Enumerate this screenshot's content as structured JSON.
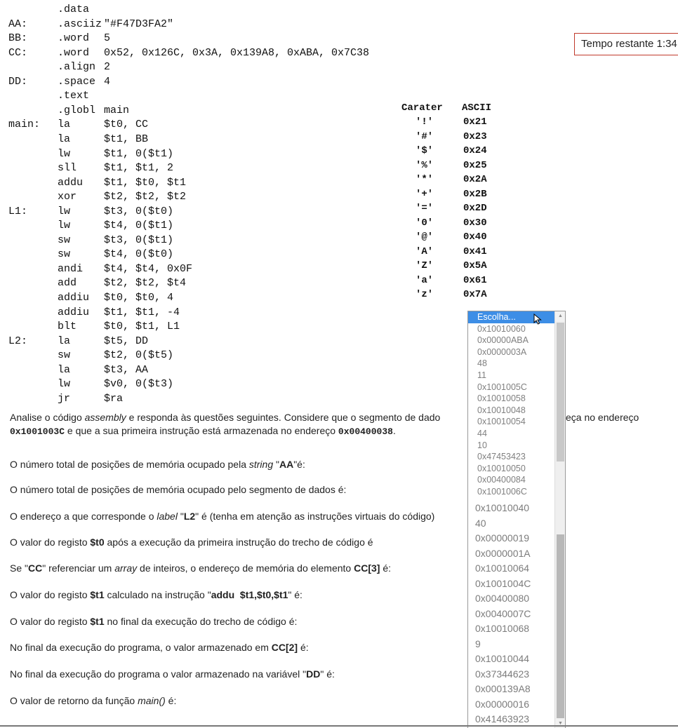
{
  "timer": {
    "text": "Tempo restante 1:34"
  },
  "code": [
    {
      "label": "",
      "op": ".data",
      "args": ""
    },
    {
      "label": "AA:",
      "op": ".asciiz",
      "args": "\"#F47D3FA2\""
    },
    {
      "label": "BB:",
      "op": ".word",
      "args": "5"
    },
    {
      "label": "CC:",
      "op": ".word",
      "args": "0x52, 0x126C, 0x3A, 0x139A8, 0xABA, 0x7C38"
    },
    {
      "label": "",
      "op": ".align",
      "args": "2"
    },
    {
      "label": "DD:",
      "op": ".space",
      "args": "4"
    },
    {
      "label": "",
      "op": ".text",
      "args": ""
    },
    {
      "label": "",
      "op": ".globl",
      "args": "main"
    },
    {
      "label": "main:",
      "op": "la",
      "args": "$t0, CC"
    },
    {
      "label": "",
      "op": "la",
      "args": "$t1, BB"
    },
    {
      "label": "",
      "op": "lw",
      "args": "$t1, 0($t1)"
    },
    {
      "label": "",
      "op": "sll",
      "args": "$t1, $t1, 2"
    },
    {
      "label": "",
      "op": "addu",
      "args": "$t1, $t0, $t1"
    },
    {
      "label": "",
      "op": "xor",
      "args": "$t2, $t2, $t2"
    },
    {
      "label": "L1:",
      "op": "lw",
      "args": "$t3, 0($t0)"
    },
    {
      "label": "",
      "op": "lw",
      "args": "$t4, 0($t1)"
    },
    {
      "label": "",
      "op": "sw",
      "args": "$t3, 0($t1)"
    },
    {
      "label": "",
      "op": "sw",
      "args": "$t4, 0($t0)"
    },
    {
      "label": "",
      "op": "andi",
      "args": "$t4, $t4, 0x0F"
    },
    {
      "label": "",
      "op": "add",
      "args": "$t2, $t2, $t4"
    },
    {
      "label": "",
      "op": "addiu",
      "args": "$t0, $t0, 4"
    },
    {
      "label": "",
      "op": "addiu",
      "args": "$t1, $t1, -4"
    },
    {
      "label": "",
      "op": "blt",
      "args": "$t0, $t1, L1"
    },
    {
      "label": "L2:",
      "op": "la",
      "args": "$t5, DD"
    },
    {
      "label": "",
      "op": "sw",
      "args": "$t2, 0($t5)"
    },
    {
      "label": "",
      "op": "la",
      "args": "$t3, AA"
    },
    {
      "label": "",
      "op": "lw",
      "args": "$v0, 0($t3)"
    },
    {
      "label": "",
      "op": "jr",
      "args": "$ra"
    }
  ],
  "ascii_table": {
    "header_char": "Carater",
    "header_code": "ASCII",
    "rows": [
      {
        "char": "'!'",
        "hex": "0x21"
      },
      {
        "char": "'#'",
        "hex": "0x23"
      },
      {
        "char": "'$'",
        "hex": "0x24"
      },
      {
        "char": "'%'",
        "hex": "0x25"
      },
      {
        "char": "'*'",
        "hex": "0x2A"
      },
      {
        "char": "'+'",
        "hex": "0x2B"
      },
      {
        "char": "'='",
        "hex": "0x2D"
      },
      {
        "char": "'0'",
        "hex": "0x30"
      },
      {
        "char": "'@'",
        "hex": "0x40"
      },
      {
        "char": "'A'",
        "hex": "0x41"
      },
      {
        "char": "'Z'",
        "hex": "0x5A"
      },
      {
        "char": "'a'",
        "hex": "0x61"
      },
      {
        "char": "'z'",
        "hex": "0x7A"
      }
    ]
  },
  "intro": {
    "p1": "Analise o código ",
    "p1_em": "assembly",
    "p2": " e responda às questões seguintes. Considere que o segmento de dado",
    "p2_cont": "eça no endereço",
    "addr1": "0x1001003C",
    "p3": " e que a sua primeira instrução está armazenada no endereço ",
    "addr2": "0x00400038",
    "p4": "."
  },
  "questions": {
    "q1": {
      "a": "O número total de posições de memória ocupado pela ",
      "em": "string",
      "b": " \"",
      "strong": "AA",
      "c": "\"é:"
    },
    "q2": {
      "a": "O número total de posições de memória ocupado pelo segmento de dados é:"
    },
    "q3": {
      "a": "O endereço a que corresponde o ",
      "em": "label",
      "b": " \"",
      "strong": "L2",
      "c": "\" é (tenha em atenção as instruções virtuais do código)"
    },
    "q4": {
      "a": "O valor do registo ",
      "strong": "$t0",
      "b": " após a execução da primeira instrução do trecho de código é"
    },
    "q5": {
      "a": "Se \"",
      "strong": "CC",
      "b": "\" referenciar um ",
      "em": "array",
      "c": " de inteiros, o endereço de memória do elemento ",
      "strong2": "CC[3]",
      "d": " é:"
    },
    "q6": {
      "a": "O valor do registo ",
      "strong": "$t1",
      "b": " calculado na instrução \"",
      "strong2": "addu  $t1,$t0,$t1",
      "c": "\" é:"
    },
    "q7": {
      "a": "O valor do registo ",
      "strong": "$t1",
      "b": " no final da execução do trecho de código é:"
    },
    "q8": {
      "a": "No final da execução do programa, o valor armazenado em ",
      "strong": "CC[2]",
      "b": " é:"
    },
    "q9": {
      "a": "No final da execução do programa o valor armazenado na variável \"",
      "strong": "DD",
      "b": "\" é:"
    },
    "q10": {
      "a": "O valor de retorno da função ",
      "em": "main()",
      "b": " é:"
    }
  },
  "dropdown": {
    "selected": "Escolha...",
    "options_small": [
      "0x10010060",
      "0x00000ABA",
      "0x0000003A",
      "48",
      "11",
      "0x1001005C",
      "0x10010058",
      "0x10010048",
      "0x10010054",
      "44",
      "10",
      "0x47453423",
      "0x10010050",
      "0x00400084",
      "0x1001006C"
    ],
    "options_large": [
      "0x10010040",
      "40",
      "0x00000019",
      "0x0000001A",
      "0x10010064",
      "0x1001004C",
      "0x00400080",
      "0x0040007C",
      "0x10010068",
      "9",
      "0x10010044",
      "0x37344623",
      "0x000139A8",
      "0x00000016",
      "0x41463923"
    ]
  }
}
